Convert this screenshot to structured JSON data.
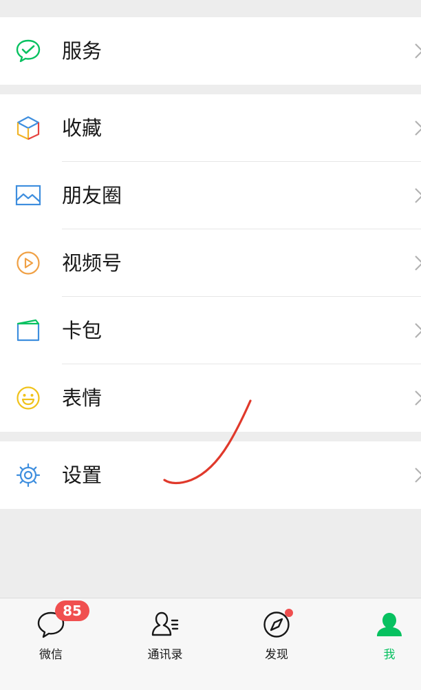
{
  "menu": {
    "services": {
      "label": "服务",
      "icon": "wechat-pay-check-icon"
    },
    "items": [
      {
        "label": "收藏",
        "icon": "cube-icon"
      },
      {
        "label": "朋友圈",
        "icon": "photo-icon"
      },
      {
        "label": "视频号",
        "icon": "play-circle-icon"
      },
      {
        "label": "卡包",
        "icon": "card-icon"
      },
      {
        "label": "表情",
        "icon": "smiley-icon"
      }
    ],
    "settings": {
      "label": "设置",
      "icon": "gear-icon"
    }
  },
  "tabbar": {
    "tabs": [
      {
        "label": "微信",
        "icon": "chat-bubble-icon",
        "badge": "85",
        "active": false
      },
      {
        "label": "通讯录",
        "icon": "contacts-icon",
        "active": false
      },
      {
        "label": "发现",
        "icon": "compass-icon",
        "has_dot": true,
        "active": false
      },
      {
        "label": "我",
        "icon": "person-icon",
        "active": true
      }
    ]
  },
  "colors": {
    "accent_green": "#07c160",
    "badge_red": "#f04f4f",
    "text": "#181818",
    "background": "#ededed"
  }
}
